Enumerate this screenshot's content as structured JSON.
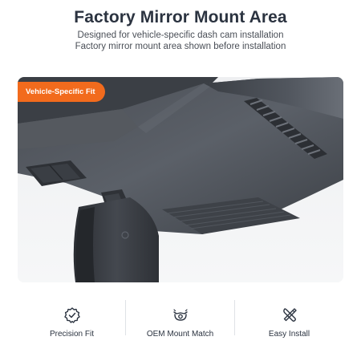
{
  "header": {
    "title": "Factory Mirror Mount Area",
    "subtitle_line1": "Designed for vehicle-specific dash cam installation",
    "subtitle_line2": "Factory mirror mount area shown before installation"
  },
  "photo": {
    "badge_label": "Vehicle-Specific Fit",
    "badge_color": "#f26b1d"
  },
  "features": [
    {
      "label": "Precision Fit",
      "icon": "badge-check-icon"
    },
    {
      "label": "OEM Mount Match",
      "icon": "camera-lens-icon"
    },
    {
      "label": "Easy Install",
      "icon": "tools-icon"
    }
  ]
}
